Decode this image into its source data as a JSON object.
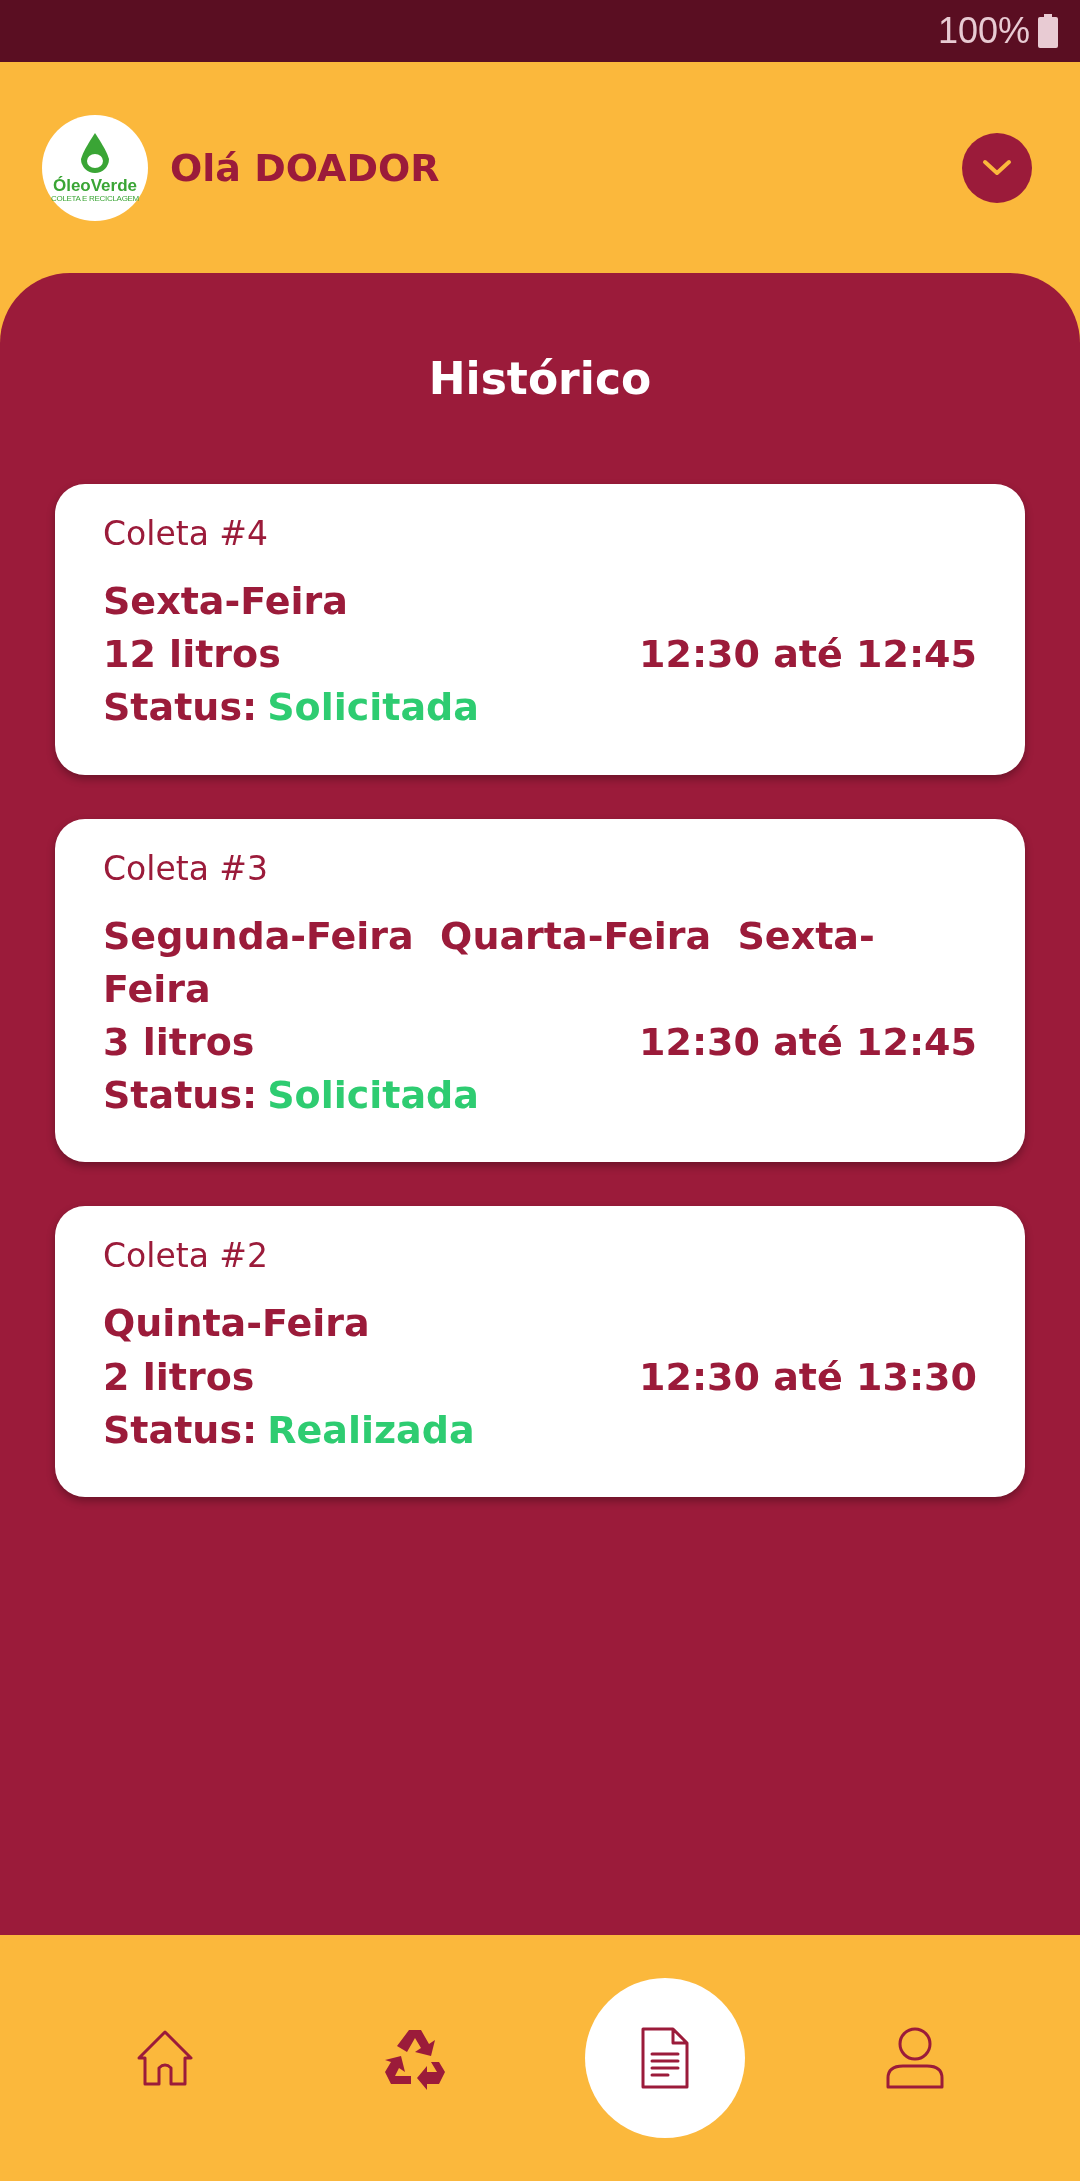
{
  "status_bar": {
    "battery": "100%"
  },
  "header": {
    "logo": {
      "name": "ÓleoVerde",
      "tagline": "COLETA E RECICLAGEM"
    },
    "greeting": "Olá DOADOR"
  },
  "title": "Histórico",
  "collections": [
    {
      "title": "Coleta #4",
      "days": "Sexta-Feira",
      "amount": "12 litros",
      "time": "12:30 até 12:45",
      "status_label": "Status:",
      "status": "Solicitada"
    },
    {
      "title": "Coleta #3",
      "days": "Segunda-Feira  Quarta-Feira  Sexta-Feira",
      "amount": "3 litros",
      "time": "12:30 até 12:45",
      "status_label": "Status:",
      "status": "Solicitada"
    },
    {
      "title": "Coleta #2",
      "days": "Quinta-Feira",
      "amount": "2 litros",
      "time": "12:30 até 13:30",
      "status_label": "Status:",
      "status": "Realizada"
    }
  ],
  "nav": [
    {
      "kind": "home",
      "selected": false
    },
    {
      "kind": "recycle",
      "selected": false
    },
    {
      "kind": "document",
      "selected": true
    },
    {
      "kind": "profile",
      "selected": false
    }
  ]
}
